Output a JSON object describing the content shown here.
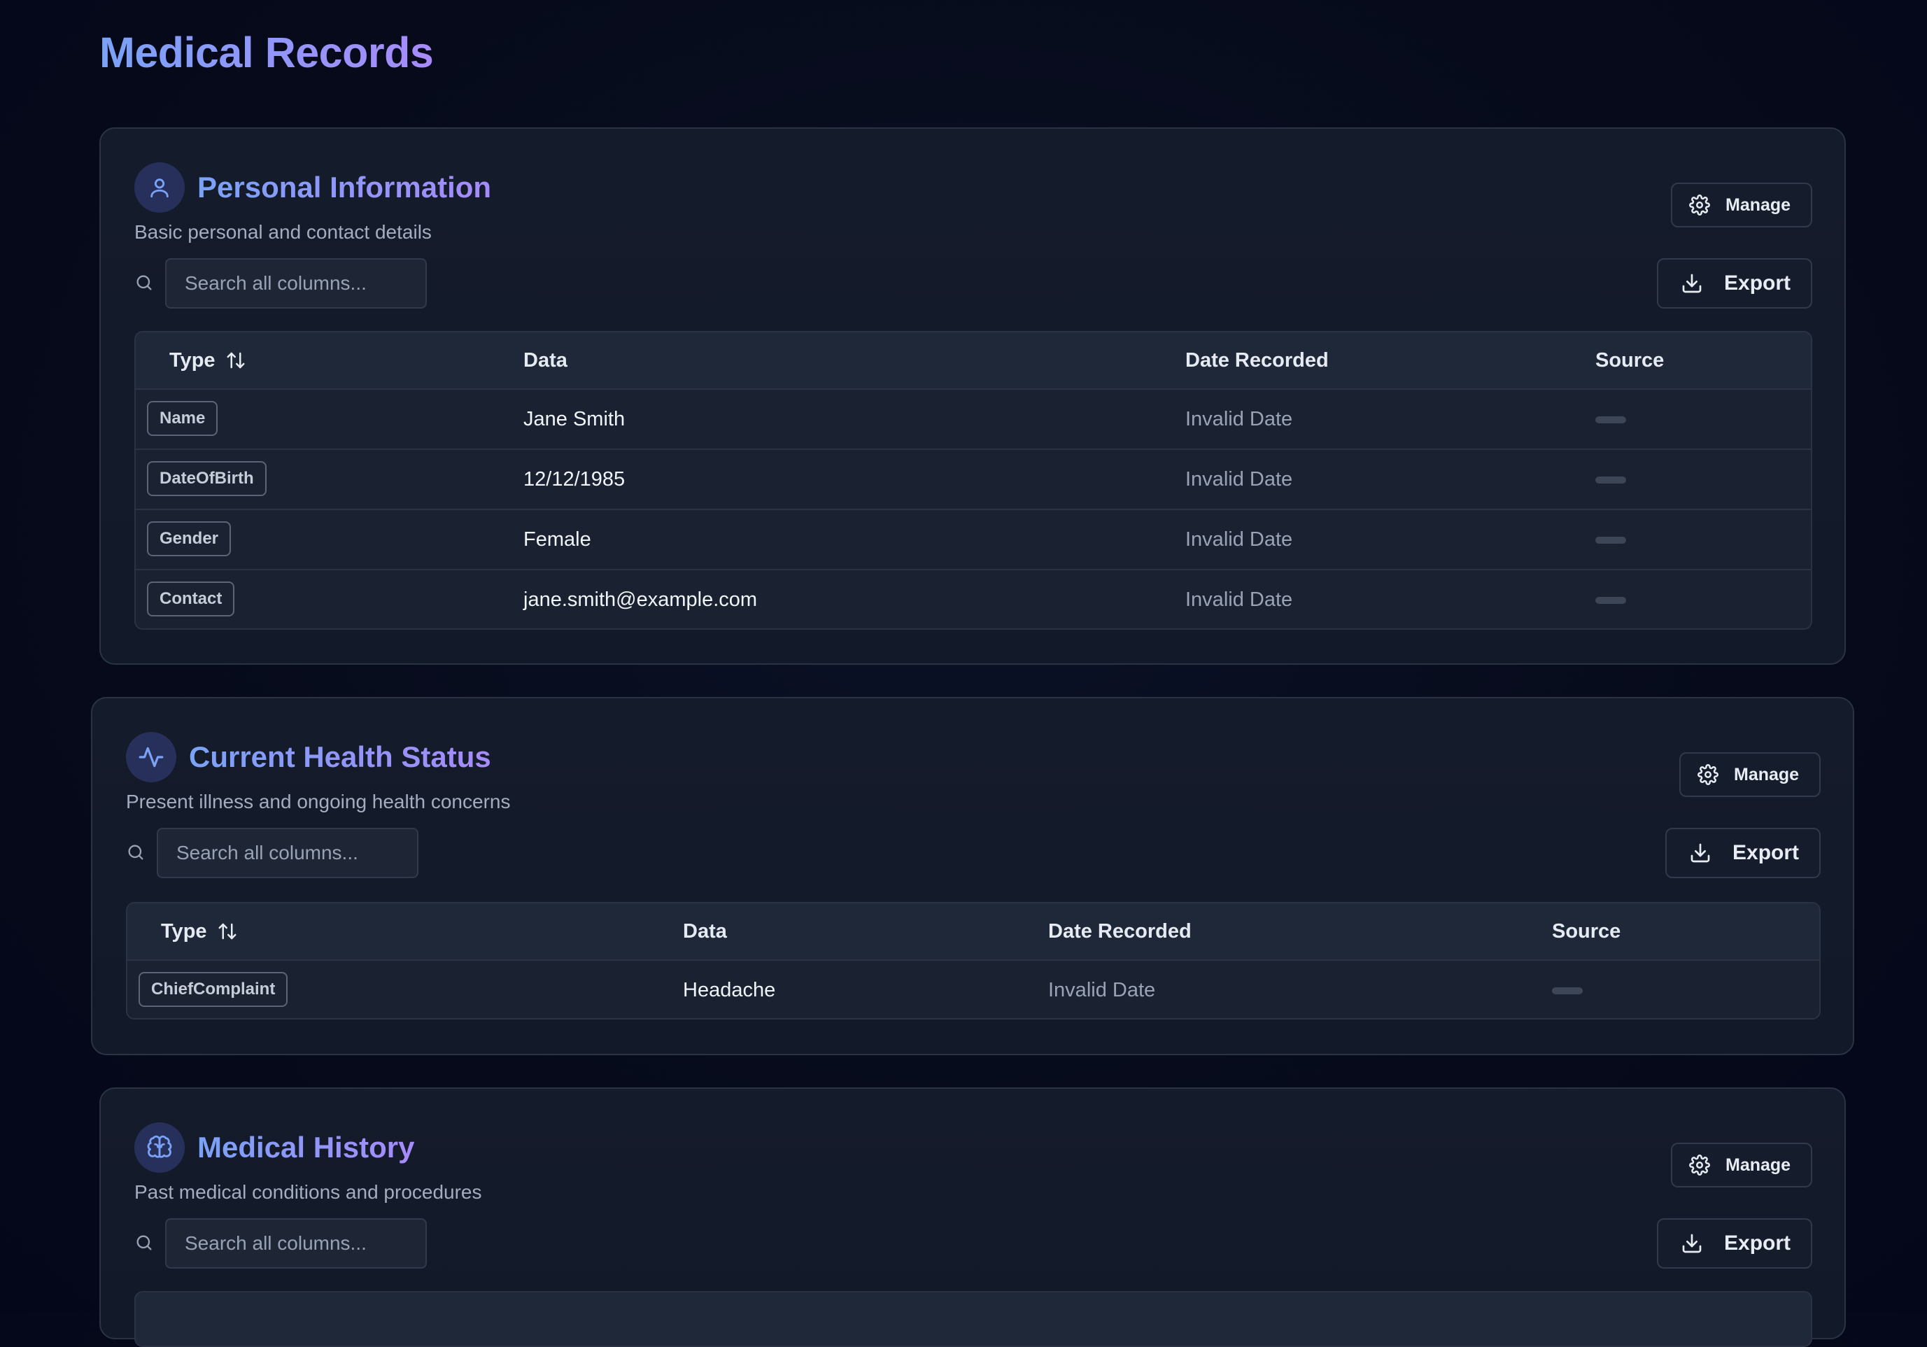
{
  "page": {
    "title": "Medical Records"
  },
  "colors": {
    "title_gradient_start": "#7aa2f7",
    "title_gradient_end": "#a78bfa",
    "background": "#060a1a",
    "card": "#141b2b"
  },
  "sections": [
    {
      "icon": "user-icon",
      "title": "Personal Information",
      "description": "Basic personal and contact details",
      "search_placeholder": "Search all columns...",
      "manage_label": "Manage",
      "export_label": "Export",
      "columns": [
        "Type",
        "Data",
        "Date Recorded",
        "Source"
      ],
      "rows": [
        {
          "type": "Name",
          "data": "Jane Smith",
          "date": "Invalid Date",
          "source": ""
        },
        {
          "type": "DateOfBirth",
          "data": "12/12/1985",
          "date": "Invalid Date",
          "source": ""
        },
        {
          "type": "Gender",
          "data": "Female",
          "date": "Invalid Date",
          "source": ""
        },
        {
          "type": "Contact",
          "data": "jane.smith@example.com",
          "date": "Invalid Date",
          "source": ""
        }
      ]
    },
    {
      "icon": "activity-icon",
      "title": "Current Health Status",
      "description": "Present illness and ongoing health concerns",
      "search_placeholder": "Search all columns...",
      "manage_label": "Manage",
      "export_label": "Export",
      "columns": [
        "Type",
        "Data",
        "Date Recorded",
        "Source"
      ],
      "rows": [
        {
          "type": "ChiefComplaint",
          "data": "Headache",
          "date": "Invalid Date",
          "source": ""
        }
      ]
    },
    {
      "icon": "brain-icon",
      "title": "Medical History",
      "description": "Past medical conditions and procedures",
      "search_placeholder": "Search all columns...",
      "manage_label": "Manage",
      "export_label": "Export"
    }
  ]
}
